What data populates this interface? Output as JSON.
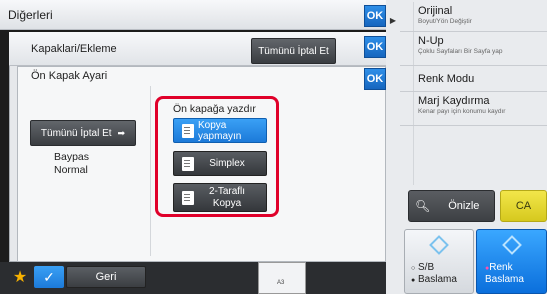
{
  "top_bar": {
    "title": "Diğerleri",
    "ok": "OK"
  },
  "layer2": {
    "title": "Kapaklari/Ekleme",
    "cancel_all": "Tümünü İptal Et",
    "ok": "OK"
  },
  "layer3": {
    "title": "Ön Kapak Ayari",
    "ok": "OK",
    "cancel_all": "Tümünü İptal Et",
    "tray_line1": "Baypas",
    "tray_line2": "Normal",
    "print_label": "Ön kapağa yazdır",
    "options": {
      "no_copy": "Kopya yapmayın",
      "simplex": "Simplex",
      "duplex_line1": "2-Taraflı",
      "duplex_line2": "Kopya"
    }
  },
  "right_panel": {
    "items": [
      {
        "title": "Orijinal",
        "sub": "Boyut/Yön Değiştir"
      },
      {
        "title": "N-Up",
        "sub": "Çoklu Sayfaları Bir Sayfa yap"
      },
      {
        "title": "Renk Modu",
        "sub": ""
      },
      {
        "title": "Marj Kaydırma",
        "sub": "Kenar payı için konumu kaydır"
      }
    ],
    "preview": "Önizle",
    "ca": "CA",
    "start_bw_line1": "S/B",
    "start_bw_line2": "Baslama",
    "start_color_line1": "Renk",
    "start_color_line2": "Baslama"
  },
  "bottom_bar": {
    "back": "Geri",
    "thumb_label": "A3"
  },
  "colors": {
    "accent_blue": "#1c7ad9",
    "highlight_red": "#e0002a",
    "ca_yellow": "#e2d52b"
  }
}
